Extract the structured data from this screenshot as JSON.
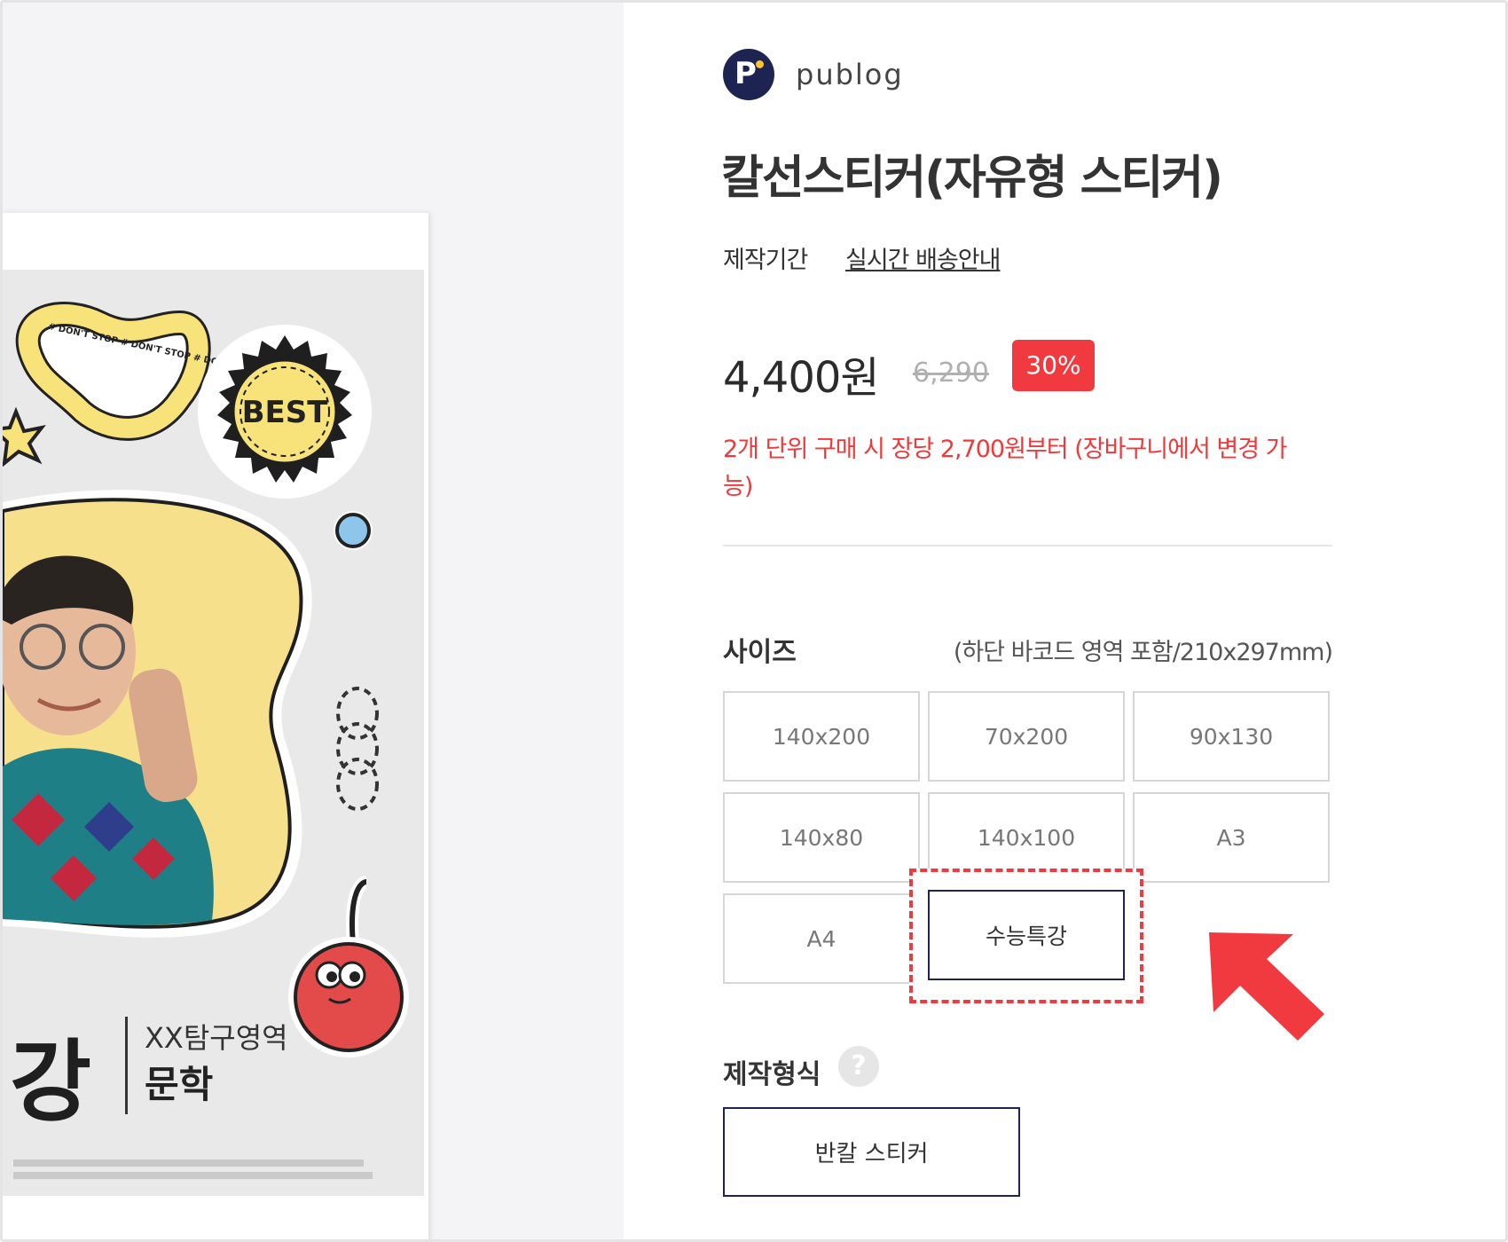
{
  "brand": {
    "name": "publog",
    "logo_letter": "P"
  },
  "product": {
    "title": "칼선스티커(자유형 스티커)",
    "production_period_label": "제작기간",
    "delivery_link": "실시간 배송안내",
    "price": "4,400원",
    "original_price": "6,290",
    "discount": "30%",
    "notice": "2개 단위 구매 시 장당 2,700원부터 (장바구니에서 변경 가능)"
  },
  "size": {
    "label": "사이즈",
    "note": "(하단 바코드 영역 포함/210x297mm)",
    "options": [
      "140x200",
      "70x200",
      "90x130",
      "140x80",
      "140x100",
      "A3",
      "A4",
      "수능특강"
    ],
    "selected": "수능특강"
  },
  "format": {
    "label": "제작형식",
    "help_icon": "?",
    "option": "반칼 스티커"
  },
  "preview": {
    "sticker_badge": "BEST",
    "sticker_loop_text": "# DON'T STOP # DON'T STOP # DON'T STOP",
    "poster_big_text": "강",
    "poster_subject": "XX탐구영역",
    "poster_subtitle": "문학"
  },
  "colors": {
    "accent": "#f03a3f",
    "navy": "#1e2452",
    "sticker_yellow": "#f8e27a",
    "cherry_red": "#e24b4a"
  }
}
